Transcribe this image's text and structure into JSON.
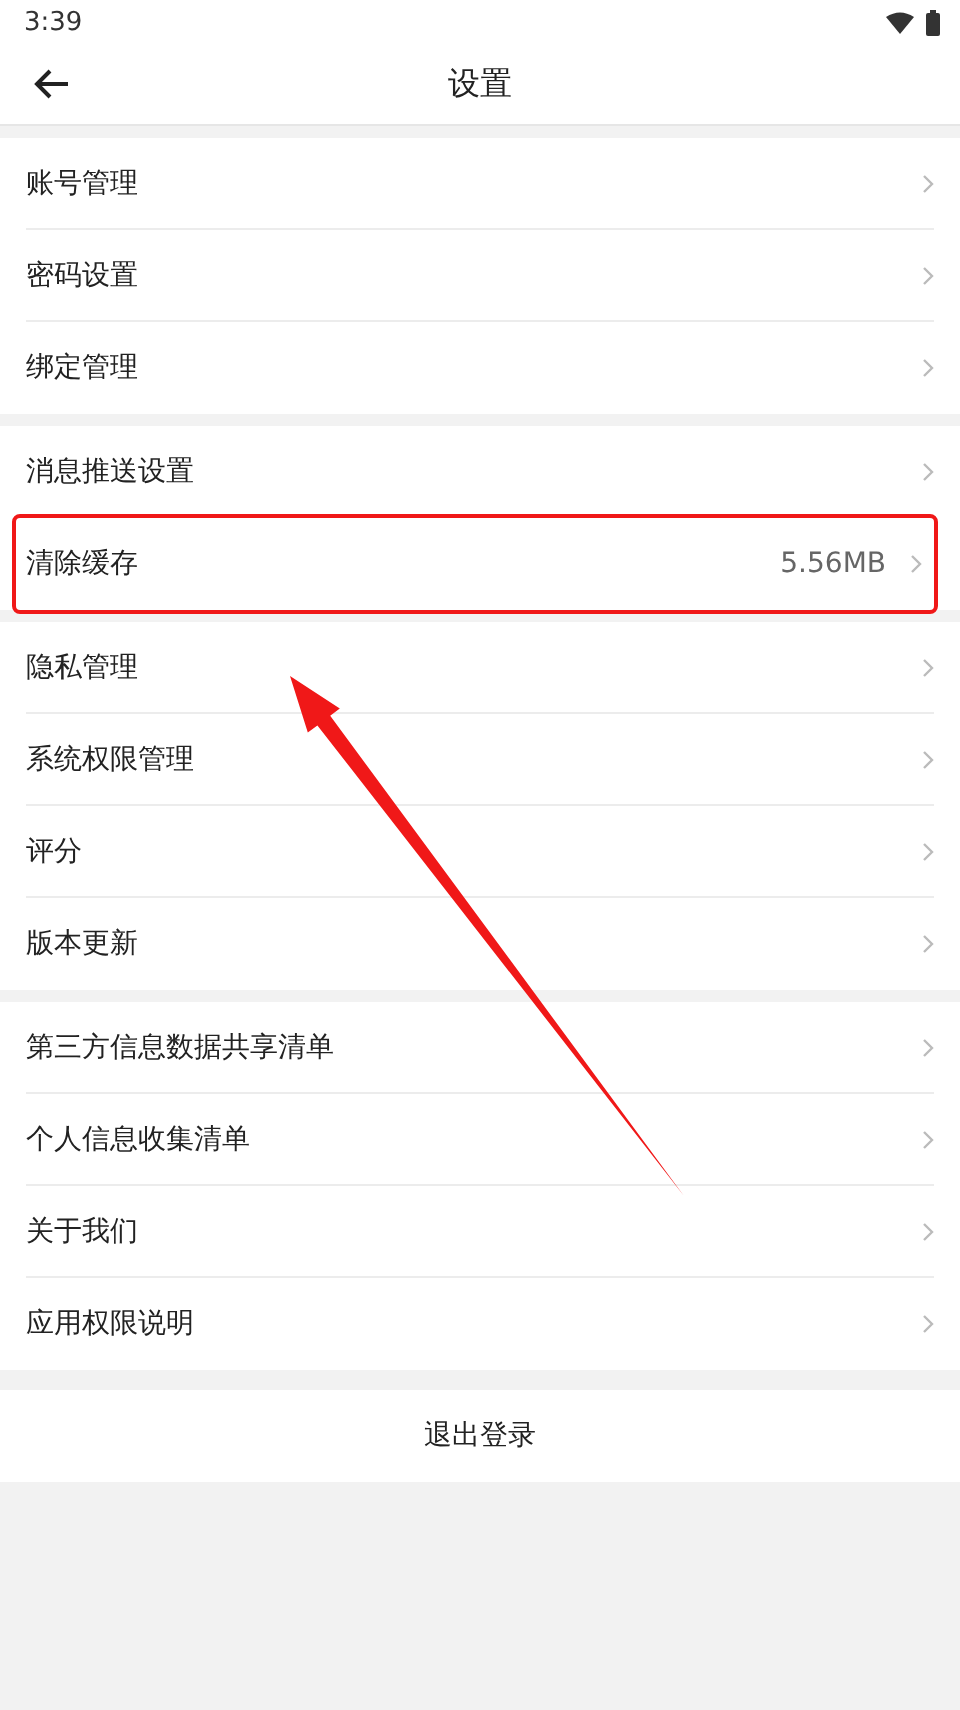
{
  "status_bar": {
    "time": "3:39"
  },
  "header": {
    "title": "设置"
  },
  "groups": [
    {
      "items": [
        {
          "label": "账号管理",
          "highlighted": false
        },
        {
          "label": "密码设置",
          "highlighted": false
        },
        {
          "label": "绑定管理",
          "highlighted": false
        }
      ]
    },
    {
      "items": [
        {
          "label": "消息推送设置",
          "highlighted": false
        },
        {
          "label": "清除缓存",
          "value": "5.56MB",
          "highlighted": true
        }
      ]
    },
    {
      "items": [
        {
          "label": "隐私管理",
          "highlighted": false
        },
        {
          "label": "系统权限管理",
          "highlighted": false
        },
        {
          "label": "评分",
          "highlighted": false
        },
        {
          "label": "版本更新",
          "highlighted": false
        }
      ]
    },
    {
      "items": [
        {
          "label": "第三方信息数据共享清单",
          "highlighted": false
        },
        {
          "label": "个人信息收集清单",
          "highlighted": false
        },
        {
          "label": "关于我们",
          "highlighted": false
        },
        {
          "label": "应用权限说明",
          "highlighted": false
        }
      ]
    }
  ],
  "logout": {
    "label": "退出登录"
  }
}
